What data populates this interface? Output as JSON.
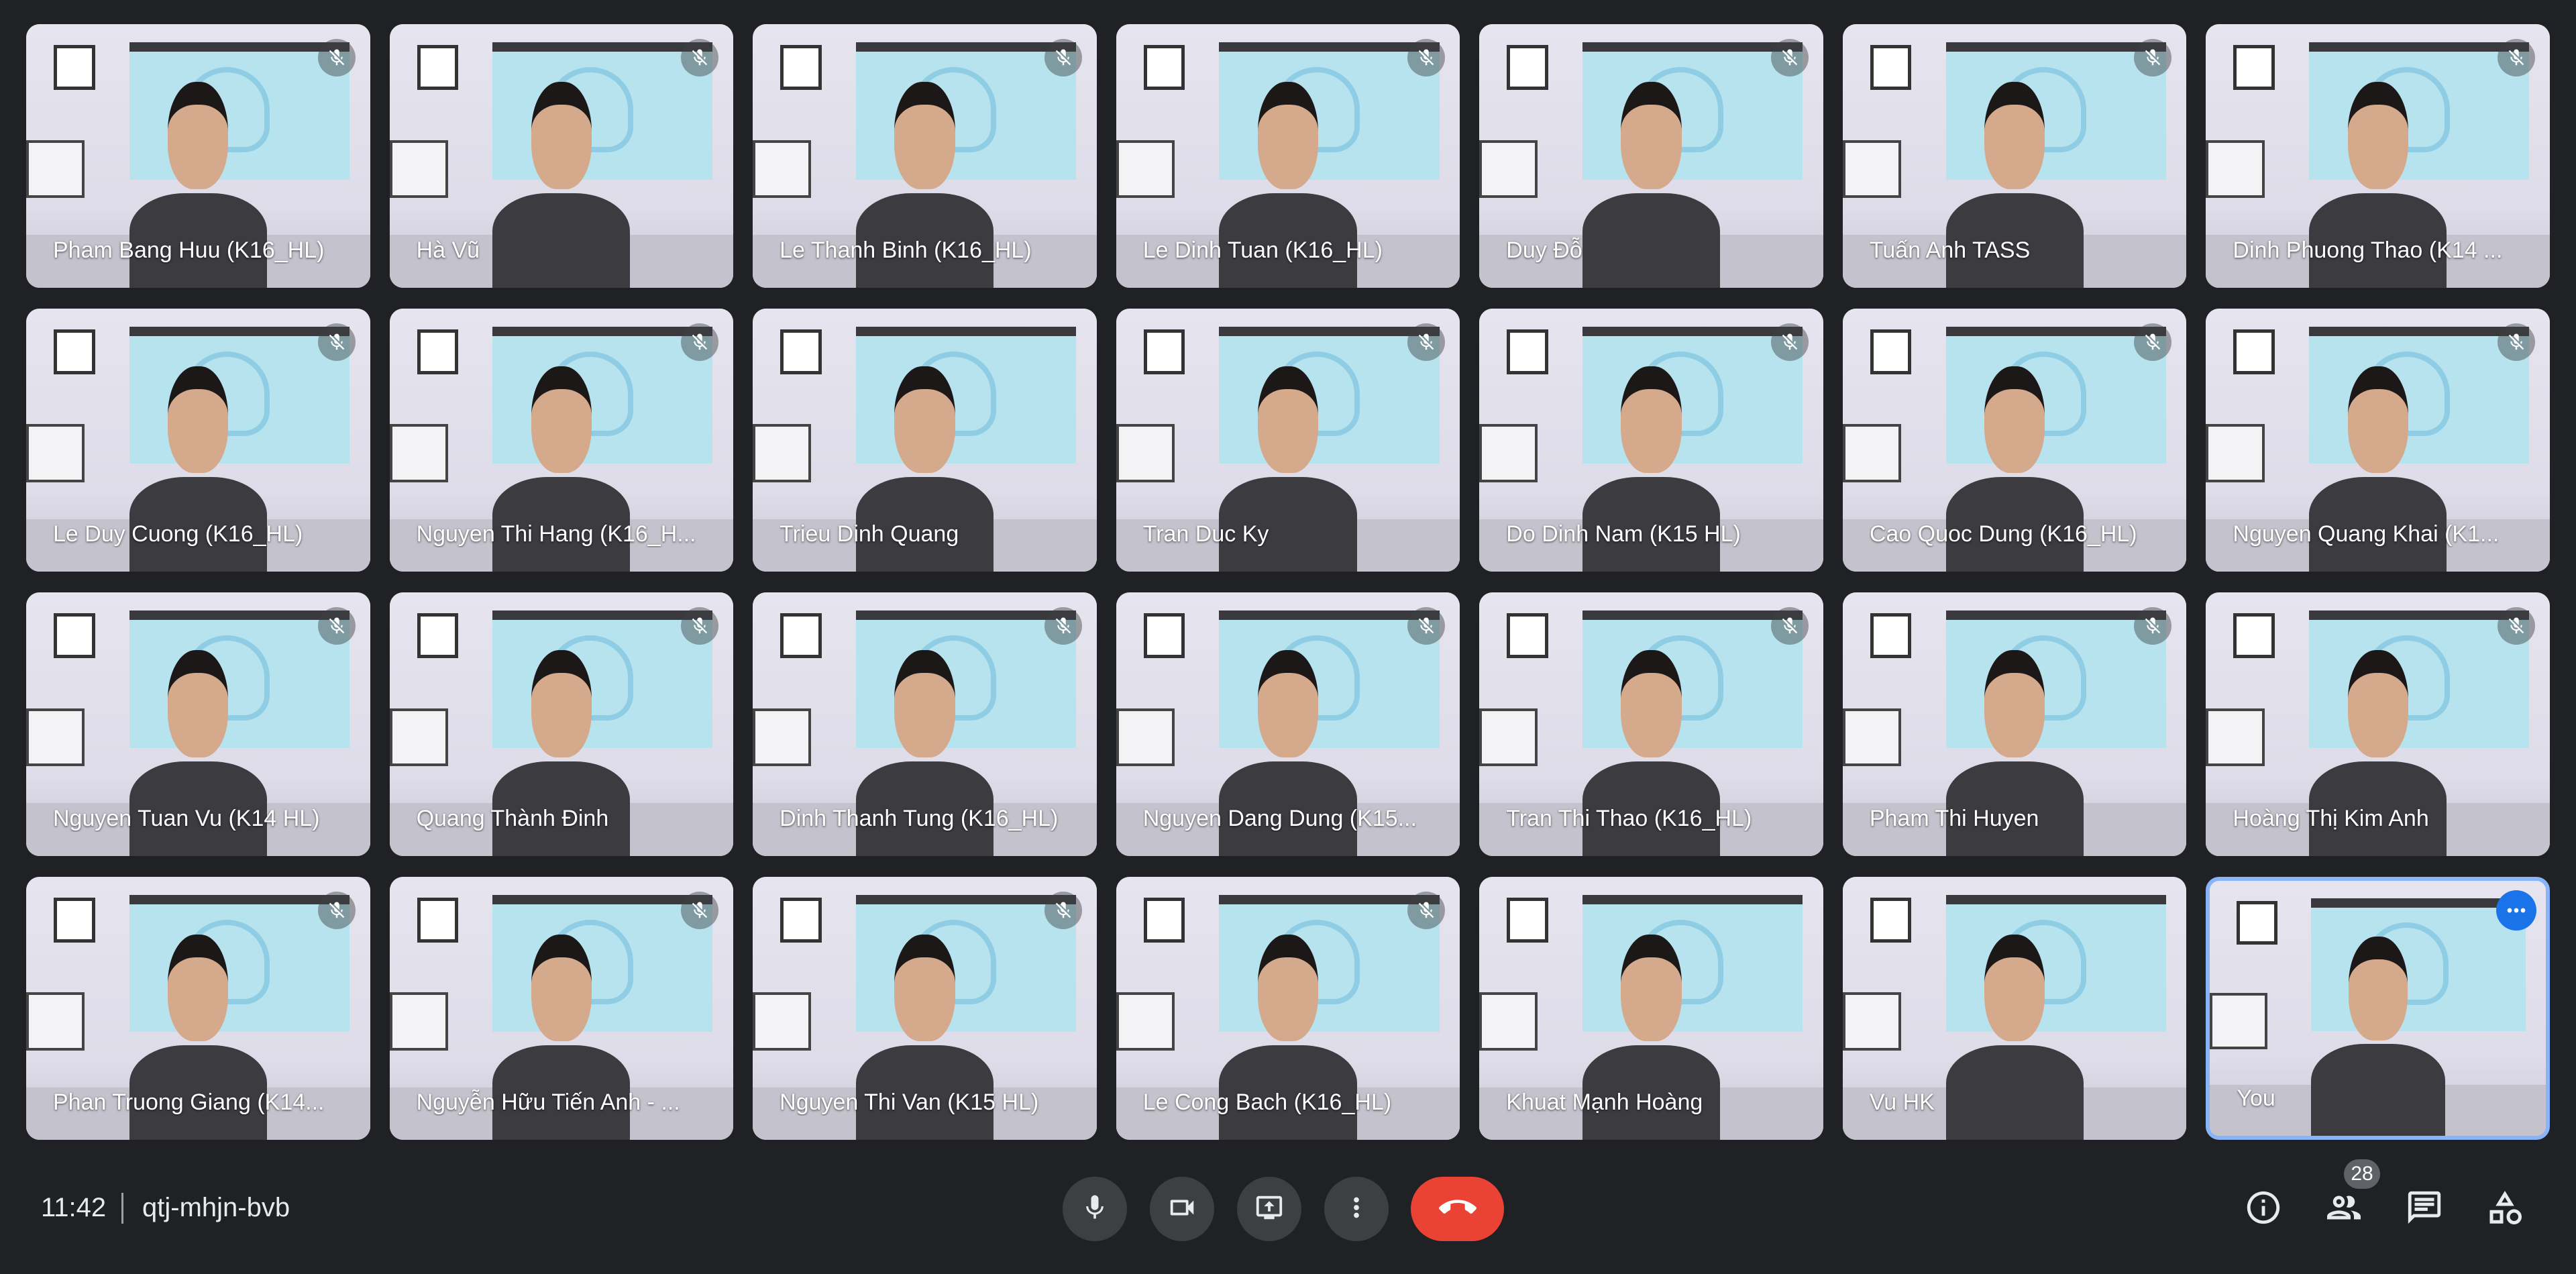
{
  "meeting": {
    "time": "11:42",
    "code": "qtj-mhjn-bvb"
  },
  "participants": [
    {
      "name": "Pham Bang Huu (K16_HL)",
      "muted": true
    },
    {
      "name": "Hà Vũ",
      "muted": true
    },
    {
      "name": "Le Thanh Binh (K16_HL)",
      "muted": true
    },
    {
      "name": "Le Dinh Tuan (K16_HL)",
      "muted": true
    },
    {
      "name": "Duy Đỗ",
      "muted": true
    },
    {
      "name": "Tuấn Anh TASS",
      "muted": true
    },
    {
      "name": "Dinh Phuong Thao (K14 ...",
      "muted": true
    },
    {
      "name": "Le Duy Cuong (K16_HL)",
      "muted": true
    },
    {
      "name": "Nguyen Thi Hang (K16_H...",
      "muted": true
    },
    {
      "name": "Trieu Dinh Quang",
      "muted": false
    },
    {
      "name": "Tran Duc Ky",
      "muted": true
    },
    {
      "name": "Do Dinh Nam (K15 HL)",
      "muted": true
    },
    {
      "name": "Cao Quoc Dung (K16_HL)",
      "muted": true
    },
    {
      "name": "Nguyen Quang Khai (K1...",
      "muted": true
    },
    {
      "name": "Nguyen Tuan Vu (K14 HL)",
      "muted": true
    },
    {
      "name": "Quang Thành Đinh",
      "muted": true
    },
    {
      "name": "Dinh Thanh Tung (K16_HL)",
      "muted": true
    },
    {
      "name": "Nguyen Dang Dung (K15...",
      "muted": true
    },
    {
      "name": "Tran Thi Thao (K16_HL)",
      "muted": true
    },
    {
      "name": "Pham Thi Huyen",
      "muted": true
    },
    {
      "name": "Hoàng Thị Kim Anh",
      "muted": true
    },
    {
      "name": "Phan Truong Giang (K14...",
      "muted": true
    },
    {
      "name": "Nguyễn Hữu Tiến Anh - ...",
      "muted": true
    },
    {
      "name": "Nguyen Thi Van (K15 HL)",
      "muted": true
    },
    {
      "name": "Le Cong Bach (K16_HL)",
      "muted": true
    },
    {
      "name": "Khuat Mạnh Hoàng",
      "muted": false
    },
    {
      "name": "Vu HK",
      "muted": false
    },
    {
      "name": "You",
      "muted": false,
      "self": true
    }
  ],
  "controls": {
    "mic_icon": "mic-icon",
    "camera_icon": "videocam-icon",
    "present_icon": "present-screen-icon",
    "more_icon": "more-vert-icon",
    "hangup_icon": "call-end-icon"
  },
  "right_controls": {
    "info_icon": "info-icon",
    "people_icon": "people-icon",
    "people_count": "28",
    "chat_icon": "chat-icon",
    "activities_icon": "activities-icon"
  },
  "colors": {
    "background": "#202124",
    "hangup": "#ea4335",
    "self_border": "#8ab4f8",
    "more_button": "#1a73e8"
  }
}
